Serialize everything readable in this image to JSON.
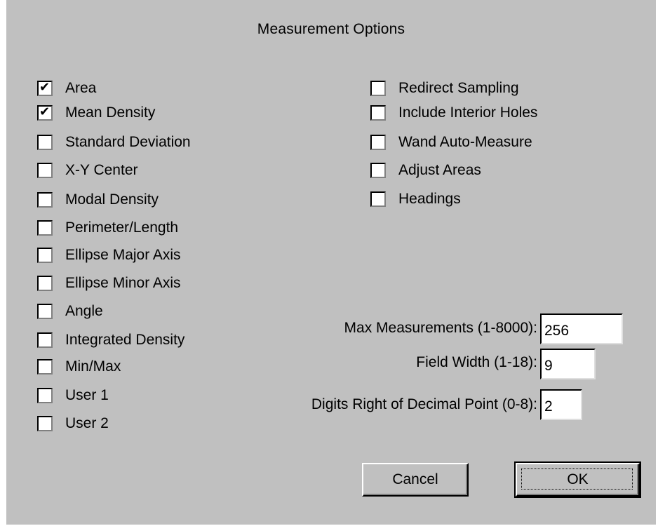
{
  "dialog": {
    "title": "Measurement Options",
    "left_options": [
      {
        "label": "Area",
        "checked": true
      },
      {
        "label": "Mean Density",
        "checked": true
      },
      {
        "label": "Standard Deviation",
        "checked": false
      },
      {
        "label": "X-Y Center",
        "checked": false
      },
      {
        "label": "Modal Density",
        "checked": false
      },
      {
        "label": "Perimeter/Length",
        "checked": false
      },
      {
        "label": "Ellipse Major Axis",
        "checked": false
      },
      {
        "label": "Ellipse Minor Axis",
        "checked": false
      },
      {
        "label": "Angle",
        "checked": false
      },
      {
        "label": "Integrated Density",
        "checked": false
      },
      {
        "label": "Min/Max",
        "checked": false
      },
      {
        "label": "User 1",
        "checked": false
      },
      {
        "label": "User 2",
        "checked": false
      }
    ],
    "right_options": [
      {
        "label": "Redirect Sampling",
        "checked": false
      },
      {
        "label": "Include Interior Holes",
        "checked": false
      },
      {
        "label": "Wand Auto-Measure",
        "checked": false
      },
      {
        "label": "Adjust Areas",
        "checked": false
      },
      {
        "label": "Headings",
        "checked": false
      }
    ],
    "fields": {
      "max_measurements": {
        "label": "Max Measurements (1-8000):",
        "value": "256"
      },
      "field_width": {
        "label": "Field Width (1-18):",
        "value": "9"
      },
      "digits_right": {
        "label": "Digits Right of Decimal Point (0-8):",
        "value": "2"
      }
    },
    "buttons": {
      "cancel": "Cancel",
      "ok": "OK"
    },
    "check_glyph": "✔"
  }
}
